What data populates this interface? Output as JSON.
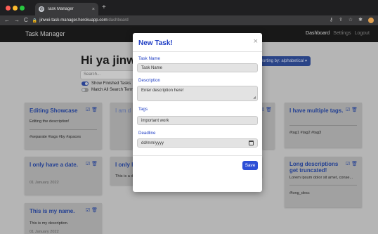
{
  "browser": {
    "tab_title": "Task Manager",
    "tab_close": "×",
    "new_tab": "+",
    "url_host": "jinwei-task-manager.herokuapp.com",
    "url_path": "/dashboard",
    "back": "←",
    "forward": "→",
    "reload": "C",
    "lock": "🔒",
    "icons": [
      "key-icon",
      "share-icon",
      "star-icon",
      "extensions-icon"
    ]
  },
  "navbar": {
    "brand": "Task Manager",
    "links": [
      "Dashboard",
      "Settings",
      "Logout"
    ]
  },
  "dashboard": {
    "greeting": "Hi ya jinwei",
    "search_placeholder": "Search...",
    "option_finished": "Show Finished Tasks",
    "option_match": "Match All Search Terms",
    "sort_label": "Sorting by: alphabetical ▾"
  },
  "cards": [
    {
      "title": "Editing Showcase",
      "body": "Editing the description!",
      "tags": "#separate #tags #by #spaces"
    },
    {
      "title": "I am d",
      "body": ""
    },
    {
      "title": "I have multiple tags.",
      "tags": "#tag1 #tag2 #tag3"
    },
    {
      "title": "I only have a date.",
      "date": "01 January 2022"
    },
    {
      "title": "I only h",
      "body": "This is a description."
    },
    {
      "title": "Long descriptions get truncated!",
      "body": "Lorem ipsum dolor sit amet, conse...",
      "tags": "#long_desc"
    },
    {
      "title": "This is my name.",
      "body": "This is my description.",
      "date": "01 January 2022"
    }
  ],
  "card_icons": [
    "edit-icon",
    "trash-icon"
  ],
  "modal": {
    "title": "New Task!",
    "close": "×",
    "task_name_label": "Task Name",
    "task_name_placeholder": "Task Name",
    "description_label": "Description",
    "description_placeholder": "Enter description here!",
    "tags_label": "Tags",
    "tags_value": "important work",
    "deadline_label": "Deadline",
    "deadline_placeholder": "dd/mm/yyyy",
    "save_label": "Save"
  },
  "colors": {
    "accent": "#1f3ec4",
    "card_title": "#2a4aa8",
    "save_button": "#2d4fd6"
  }
}
